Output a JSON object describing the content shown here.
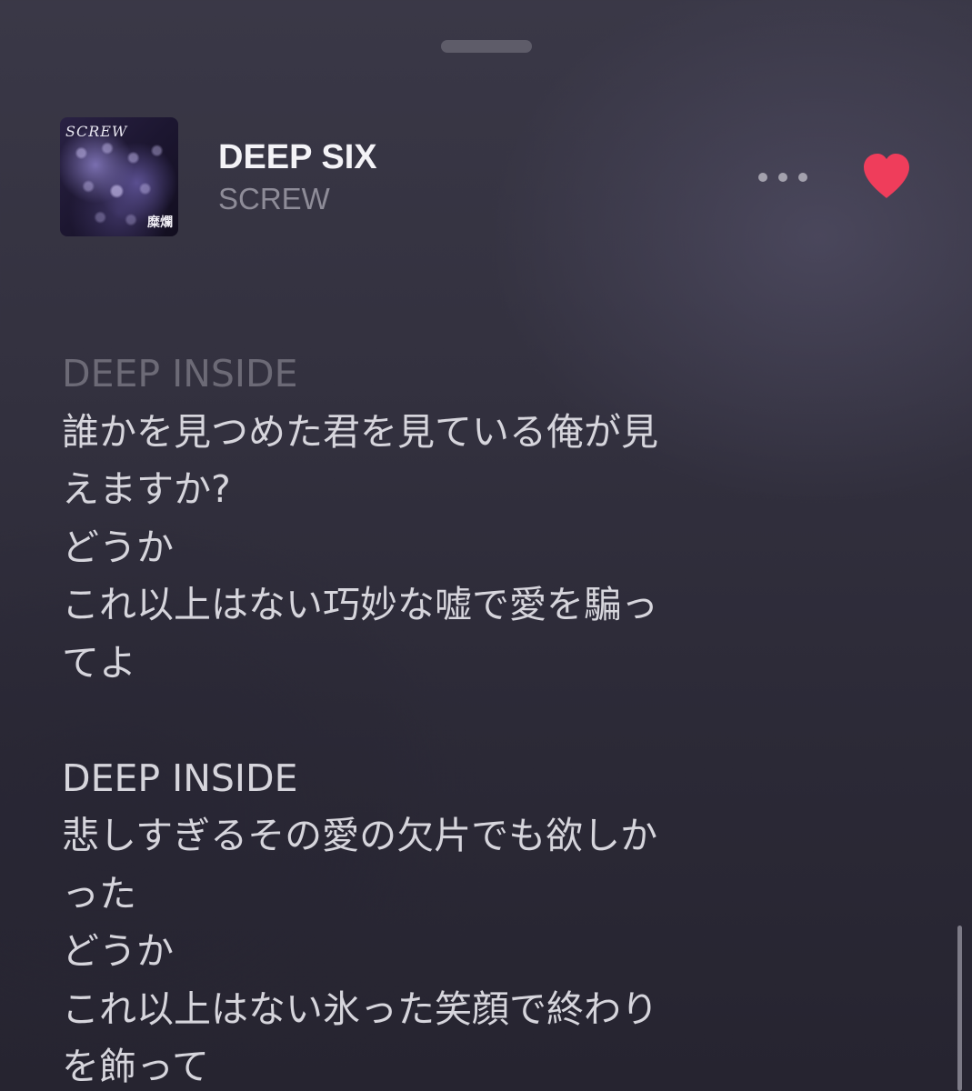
{
  "now_playing": {
    "title": "DEEP SIX",
    "artist": "SCREW",
    "artwork": {
      "logo_text": "SCREW",
      "subtitle_text": "糜爛"
    },
    "favorited": true,
    "heart_color": "#ef3d5b"
  },
  "icons": {
    "more": "more-horizontal-icon",
    "favorite": "heart-filled-icon"
  },
  "lyrics": [
    {
      "text": "DEEP INSIDE",
      "faded": true
    },
    {
      "text": "誰かを見つめた君を見ている俺が見",
      "faded": false
    },
    {
      "text": "えますか?",
      "faded": false
    },
    {
      "text": "どうか",
      "faded": false
    },
    {
      "text": "これ以上はない巧妙な嘘で愛を騙っ",
      "faded": false
    },
    {
      "text": "てよ",
      "faded": false
    },
    {
      "text": "",
      "faded": false
    },
    {
      "text": "DEEP INSIDE",
      "faded": false
    },
    {
      "text": "悲しすぎるその愛の欠片でも欲しか",
      "faded": false
    },
    {
      "text": "った",
      "faded": false
    },
    {
      "text": "どうか",
      "faded": false
    },
    {
      "text": "これ以上はない氷った笑顔で終わり",
      "faded": false
    },
    {
      "text": "を飾って",
      "faded": false
    }
  ]
}
